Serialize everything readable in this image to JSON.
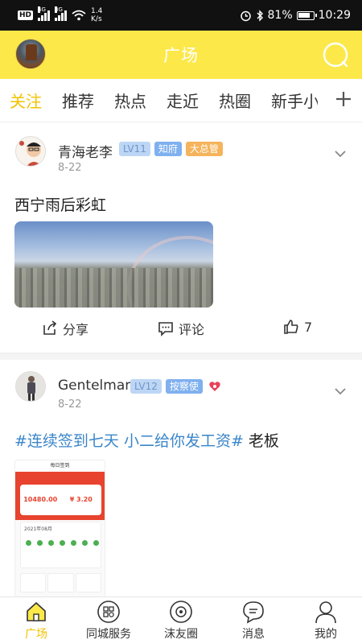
{
  "status_bar": {
    "hd": "HD",
    "net1": "4G",
    "net2": "3G",
    "speed_value": "1.4",
    "speed_unit": "K/s",
    "battery": "81%",
    "time": "10:29"
  },
  "header": {
    "title": "广场"
  },
  "tabs": [
    "关注",
    "推荐",
    "热点",
    "走近",
    "热圈",
    "新手小"
  ],
  "posts": [
    {
      "username": "青海老李",
      "level": "LV11",
      "badges": [
        "知府",
        "大总管"
      ],
      "date": "8-22",
      "text": "西宁雨后彩虹",
      "share_label": "分享",
      "comment_label": "评论",
      "likes": "7"
    },
    {
      "username": "Gentelman",
      "level": "LV12",
      "badges": [
        "按察使"
      ],
      "date": "8-22",
      "hashtag": "#连续签到七天 小二给你发工资#",
      "text_after": " 老板",
      "image": {
        "title": "每日签到",
        "amount_left": "10480.00",
        "amount_right": "¥ 3.20",
        "month": "2021年08月"
      }
    }
  ],
  "bottom_nav": [
    "广场",
    "同城服务",
    "沫友圈",
    "消息",
    "我的"
  ],
  "colors": {
    "accent": "#fde84a",
    "tab_active": "#f2c200",
    "hashtag": "#3b86c9"
  }
}
